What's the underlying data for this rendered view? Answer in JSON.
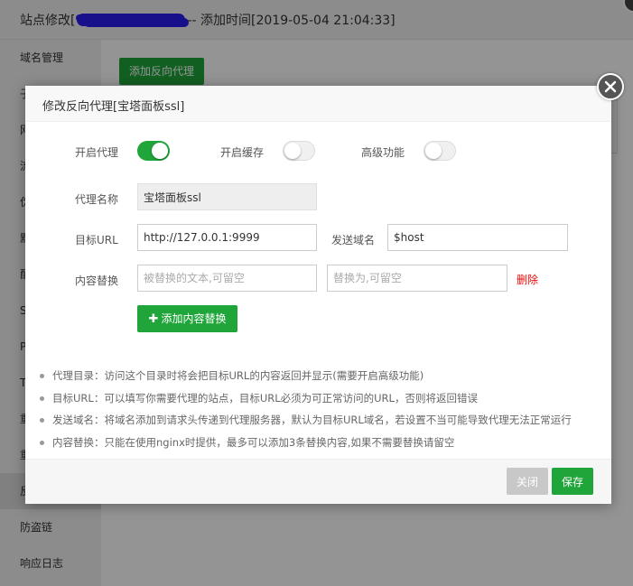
{
  "background": {
    "title_prefix": "站点修改[",
    "title_suffix": "-- 添加时间[2019-05-04 21:04:33]",
    "add_button": "添加反向代理",
    "sidebar_items": [
      "域名管理",
      "子",
      "网",
      "流",
      "伪",
      "默",
      "配",
      "S",
      "P",
      "T",
      "重",
      "重",
      "反",
      "防盗链",
      "响应日志"
    ]
  },
  "modal": {
    "title": "修改反向代理[宝塔面板ssl]",
    "toggles": {
      "proxy": {
        "label": "开启代理",
        "state": "on"
      },
      "cache": {
        "label": "开启缓存",
        "state": "off"
      },
      "advanced": {
        "label": "高级功能",
        "state": "off"
      }
    },
    "fields": {
      "name": {
        "label": "代理名称",
        "value": "宝塔面板ssl"
      },
      "target": {
        "label": "目标URL",
        "value": "http://127.0.0.1:9999"
      },
      "host": {
        "label": "发送域名",
        "value": "$host"
      },
      "replace": {
        "label": "内容替换",
        "from_placeholder": "被替换的文本,可留空",
        "to_placeholder": "替换为,可留空",
        "delete": "删除"
      }
    },
    "add_replace_button": "添加内容替换",
    "notes": [
      "代理目录：访问这个目录时将会把目标URL的内容返回并显示(需要开启高级功能)",
      "目标URL：可以填写你需要代理的站点，目标URL必须为可正常访问的URL，否则将返回错误",
      "发送域名：将域名添加到请求头传递到代理服务器，默认为目标URL域名，若设置不当可能导致代理无法正常运行",
      "内容替换：只能在使用nginx时提供，最多可以添加3条替换内容,如果不需要替换请留空"
    ],
    "footer": {
      "close": "关闭",
      "save": "保存"
    }
  },
  "colors": {
    "accent": "#20a53a",
    "danger": "#ef0808",
    "disabled": "#c8c8c8"
  },
  "icons": {
    "close": "close-icon",
    "plus": "plus-icon"
  }
}
